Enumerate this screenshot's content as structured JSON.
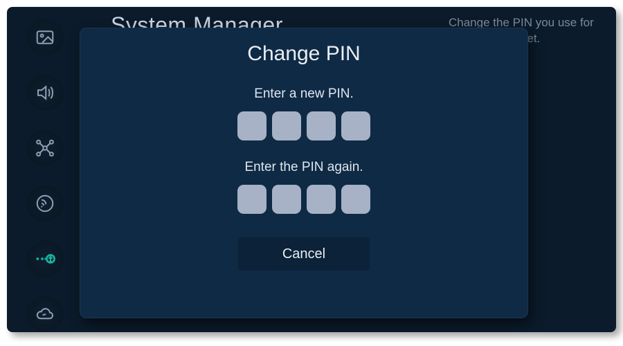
{
  "background": {
    "title": "System Manager",
    "help_text": "Change the PIN you use for settings or Reset."
  },
  "sidebar": {
    "items": [
      {
        "name": "picture-icon",
        "active": false
      },
      {
        "name": "sound-icon",
        "active": false
      },
      {
        "name": "network-icon",
        "active": false
      },
      {
        "name": "broadcast-icon",
        "active": false
      },
      {
        "name": "accessibility-icon",
        "active": true
      },
      {
        "name": "cloud-icon",
        "active": false
      }
    ]
  },
  "modal": {
    "title": "Change PIN",
    "new_pin_prompt": "Enter a new PIN.",
    "confirm_pin_prompt": "Enter the PIN again.",
    "cancel_label": "Cancel",
    "pin_length": 4
  }
}
